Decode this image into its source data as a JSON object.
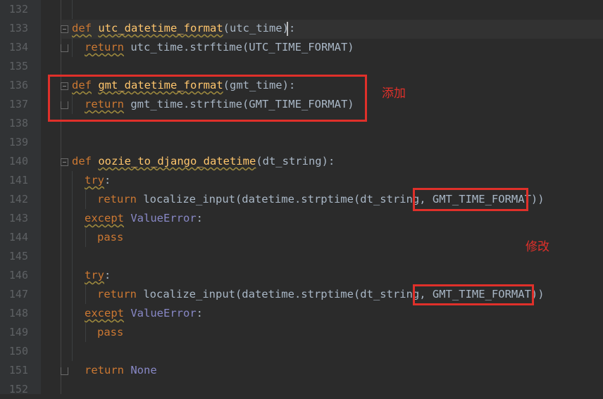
{
  "editor": {
    "line_numbers": [
      "132",
      "133",
      "134",
      "135",
      "136",
      "137",
      "138",
      "139",
      "140",
      "141",
      "142",
      "143",
      "144",
      "145",
      "146",
      "147",
      "148",
      "149",
      "150",
      "151",
      "152"
    ],
    "lines": {
      "l133": {
        "kw": "def",
        "fn": "utc_datetime_format",
        "rest": "(utc_time):"
      },
      "l134": {
        "kw": "return",
        "rest": " utc_time.strftime(UTC_TIME_FORMAT)"
      },
      "l136": {
        "kw": "def",
        "fn": "gmt_datetime_format",
        "rest": "(gmt_time):"
      },
      "l137": {
        "kw": "return",
        "rest": " gmt_time.strftime(GMT_TIME_FORMAT)"
      },
      "l140": {
        "kw": "def",
        "fn": "oozie_to_django_datetime",
        "rest": "(dt_string):"
      },
      "l141": {
        "kw": "try",
        "rest": ":"
      },
      "l142": {
        "kw": "return",
        "rest": " localize_input(datetime.strptime(dt_string, GMT_TIME_FORMAT))"
      },
      "l143": {
        "kw": "except",
        "bi": "ValueError",
        "rest": ":"
      },
      "l144": {
        "kw": "pass"
      },
      "l146": {
        "kw": "try",
        "rest": ":"
      },
      "l147": {
        "kw": "return",
        "rest": " localize_input(datetime.strptime(dt_string, GMT_TIME_FORMAT))"
      },
      "l148": {
        "kw": "except",
        "bi": "ValueError",
        "rest": ":"
      },
      "l149": {
        "kw": "pass"
      },
      "l151": {
        "kw": "return",
        "bi": "None"
      }
    }
  },
  "annotations": {
    "added_label": "添加",
    "modified_label": "修改"
  },
  "colors": {
    "background": "#2b2b2b",
    "keyword": "#cc7832",
    "function": "#ffc66d",
    "builtin": "#8888c6",
    "text": "#a9b7c6",
    "annotation": "#e0302a"
  }
}
